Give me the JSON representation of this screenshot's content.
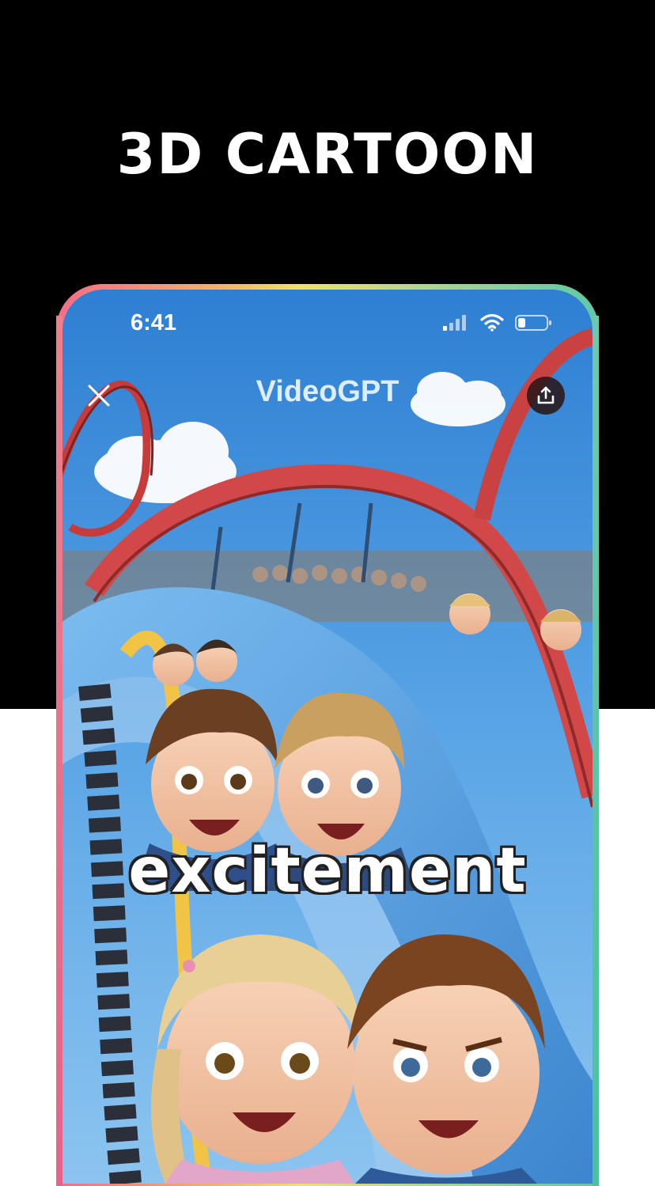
{
  "headline": "3D CARTOON",
  "status_bar": {
    "time": "6:41"
  },
  "nav": {
    "title": "VideoGPT",
    "close_icon": "close-icon",
    "share_icon": "share-upload-icon"
  },
  "video": {
    "caption": "excitement"
  },
  "colors": {
    "background_top": "#000000",
    "background_bottom": "#ffffff",
    "sky": "#4f9fe0",
    "track_blue": "#5aa8e8",
    "track_red": "#d94a4a",
    "track_yellow": "#f1c445"
  }
}
